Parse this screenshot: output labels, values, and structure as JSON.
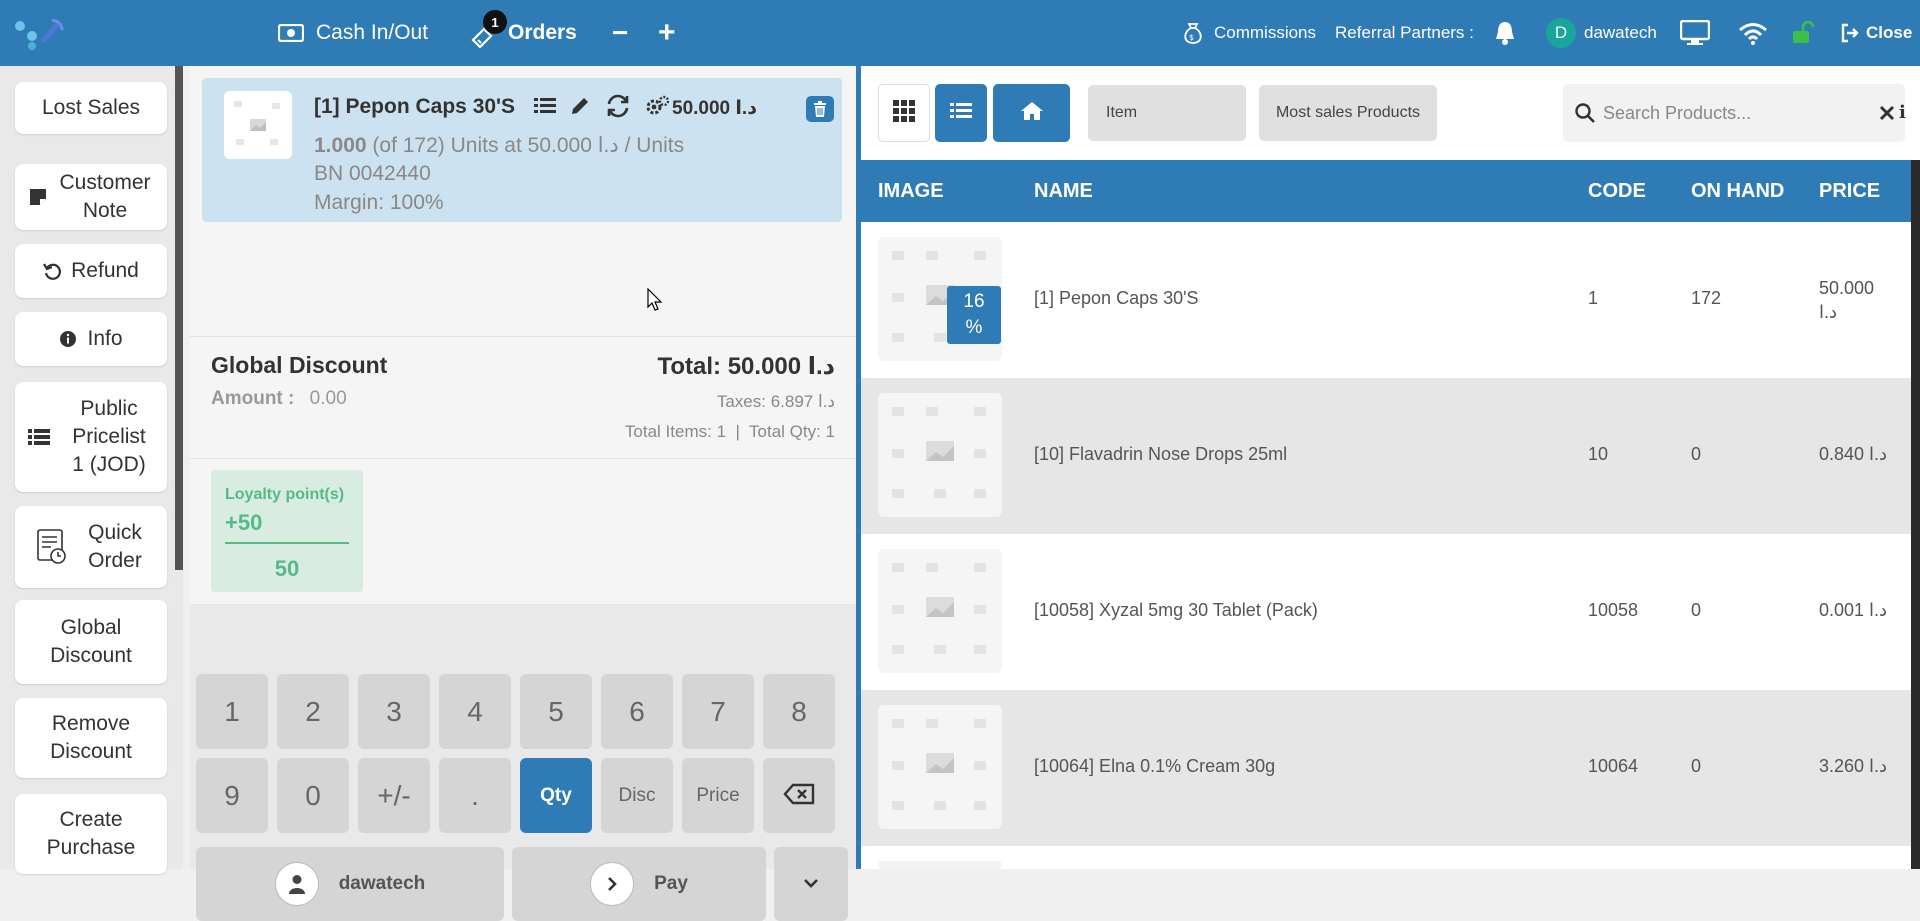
{
  "topbar": {
    "cash_in_out": "Cash In/Out",
    "orders_label": "Orders",
    "orders_badge": "1",
    "minus": "−",
    "plus": "+",
    "commissions": "Commissions",
    "referral": "Referral Partners :",
    "user_initial": "D",
    "user_name": "dawatech",
    "close": "Close"
  },
  "actions": {
    "lost_sales": "Lost Sales",
    "customer_note": "Customer Note",
    "refund": "Refund",
    "info": "Info",
    "pricelist": "Public Pricelist 1 (JOD)",
    "quick_order": "Quick Order",
    "global_discount": "Global Discount",
    "remove_discount": "Remove Discount",
    "create_purchase": "Create Purchase"
  },
  "order_line": {
    "title": "[1] Pepon Caps 30'S",
    "price": "50.000 د.ا",
    "qty": "1.000",
    "qty_detail": "(of 172) Units at 50.000 د.ا / Units",
    "batch": "BN 0042440",
    "margin": "Margin: 100%"
  },
  "summary": {
    "global_discount": "Global Discount",
    "amount_label": "Amount :",
    "amount_value": "0.00",
    "total": "Total: 50.000 د.ا",
    "taxes": "Taxes: 6.897 د.ا",
    "totals": "Total Items: 1  |  Total Qty: 1"
  },
  "loyalty": {
    "label": "Loyalty point(s)",
    "plus": "+50",
    "value": "50"
  },
  "numpad": {
    "k1": "1",
    "k2": "2",
    "k3": "3",
    "k4": "4",
    "k5": "5",
    "k6": "6",
    "k7": "7",
    "k8": "8",
    "k9": "9",
    "k0": "0",
    "kpm": "+/-",
    "kdot": ".",
    "qty": "Qty",
    "disc": "Disc",
    "price": "Price",
    "customer": "dawatech",
    "pay": "Pay"
  },
  "products": {
    "crumb_item": "Item",
    "crumb_most": "Most sales Products",
    "search_placeholder": "Search Products...",
    "columns": {
      "image": "IMAGE",
      "name": "NAME",
      "code": "CODE",
      "on_hand": "ON HAND",
      "price": "PRICE"
    },
    "rows": [
      {
        "name": "[1] Pepon Caps 30'S",
        "code": "1",
        "on_hand": "172",
        "price_line1": "50.000",
        "price_line2": "د.ا",
        "discount": "16",
        "discount_unit": "%"
      },
      {
        "name": "[10] Flavadrin Nose Drops 25ml",
        "code": "10",
        "on_hand": "0",
        "price": "0.840 د.ا"
      },
      {
        "name": "[10058] Xyzal 5mg 30 Tablet (Pack)",
        "code": "10058",
        "on_hand": "0",
        "price": "0.001 د.ا"
      },
      {
        "name": "[10064] Elna 0.1% Cream 30g",
        "code": "10064",
        "on_hand": "0",
        "price": "3.260 د.ا"
      }
    ]
  },
  "colors": {
    "primary": "#2e7bb6",
    "row_alt": "#e6e6e6",
    "loyalty": "#55b988",
    "order_line": "#cde2f0"
  }
}
